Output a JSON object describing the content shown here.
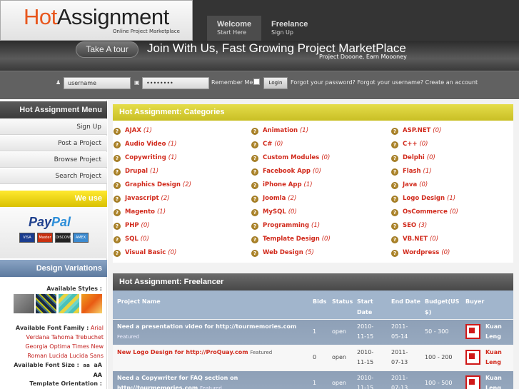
{
  "logo": {
    "hot": "Hot",
    "assignment": "Assignment",
    "subtitle": "Online Project Marketplace"
  },
  "nav": [
    {
      "main": "Welcome",
      "sub": "Start Here"
    },
    {
      "main": "Freelance",
      "sub": "Sign Up"
    }
  ],
  "banner": {
    "tour_button": "Take A tour",
    "headline": "Join With Us, Fast Growing Project MarketPlace",
    "tagline": "Project Dooone,  Earn Moooney"
  },
  "login": {
    "username_value": "username",
    "password_value": "••••••••",
    "remember_label": "Remember Me",
    "login_button": "Login",
    "forgot_text": "Forgot your password? Forgot your username? Create an account",
    "user_icon": "user-icon",
    "lock_icon": "lock-icon"
  },
  "sidebar": {
    "menu_title": "Hot Assignment Menu",
    "items": [
      "Sign Up",
      "Post a Project",
      "Browse Project",
      "Search Project"
    ],
    "we_use": "We use",
    "paypal": {
      "pay": "Pay",
      "pal": "Pal"
    },
    "cards": [
      "VISA",
      "Master",
      "DISCOVER",
      "AMEX"
    ],
    "design_title": "Design Variations",
    "styles_label": "Available Styles :",
    "font_family_label": "Available Font Family :",
    "fonts": [
      "Arial",
      "Verdana",
      "Tahoma",
      "Trebuchet",
      "Georgia",
      "Optima",
      "Times New Roman",
      "Lucida",
      "Lucida Sans"
    ],
    "font_size_label": "Available Font Size :",
    "font_sizes": [
      "aa",
      "aA",
      "AA"
    ],
    "orientation_label": "Template Orientation :"
  },
  "categories": {
    "title": "Hot Assignment: Categories",
    "items": [
      {
        "name": "AJAX",
        "count": "(1)"
      },
      {
        "name": "Animation",
        "count": "(1)"
      },
      {
        "name": "ASP.NET",
        "count": "(0)"
      },
      {
        "name": "Audio Video",
        "count": "(1)"
      },
      {
        "name": "C#",
        "count": "(0)"
      },
      {
        "name": "C++",
        "count": "(0)"
      },
      {
        "name": "Copywriting",
        "count": "(1)"
      },
      {
        "name": "Custom Modules",
        "count": "(0)"
      },
      {
        "name": "Delphi",
        "count": "(0)"
      },
      {
        "name": "Drupal",
        "count": "(1)"
      },
      {
        "name": "Facebook App",
        "count": "(0)"
      },
      {
        "name": "Flash",
        "count": "(1)"
      },
      {
        "name": "Graphics Design",
        "count": "(2)"
      },
      {
        "name": "iPhone App",
        "count": "(1)"
      },
      {
        "name": "Java",
        "count": "(0)"
      },
      {
        "name": "Javascript",
        "count": "(2)"
      },
      {
        "name": "Joomla",
        "count": "(2)"
      },
      {
        "name": "Logo Design",
        "count": "(1)"
      },
      {
        "name": "Magento",
        "count": "(1)"
      },
      {
        "name": "MySQL",
        "count": "(0)"
      },
      {
        "name": "OsCommerce",
        "count": "(0)"
      },
      {
        "name": "PHP",
        "count": "(0)"
      },
      {
        "name": "Programming",
        "count": "(1)"
      },
      {
        "name": "SEO",
        "count": "(3)"
      },
      {
        "name": "SQL",
        "count": "(0)"
      },
      {
        "name": "Template Design",
        "count": "(0)"
      },
      {
        "name": "VB.NET",
        "count": "(0)"
      },
      {
        "name": "Visual Basic",
        "count": "(0)"
      },
      {
        "name": "Web Design",
        "count": "(5)"
      },
      {
        "name": "Wordpress",
        "count": "(0)"
      }
    ]
  },
  "freelancer": {
    "title": "Hot Assignment: Freelancer",
    "columns": {
      "project": "Project Name",
      "bids": "Bids",
      "status": "Status",
      "start": "Start Date",
      "end": "End Date",
      "budget": "Budget(US $)",
      "buyer": "Buyer"
    },
    "rows": [
      {
        "title": "Need a presentation video for http://tourmemories.com",
        "tag": "Featured",
        "bids": "1",
        "status": "open",
        "start": "2010-11-15",
        "end": "2011-05-14",
        "budget": "50 - 300",
        "buyer": "Kuan Leng"
      },
      {
        "title": "New Logo Design for http://ProQuay.com",
        "tag": "Featured",
        "bids": "0",
        "status": "open",
        "start": "2010-11-15",
        "end": "2011-07-13",
        "budget": "100 - 200",
        "buyer": "Kuan Leng"
      },
      {
        "title": "Need a Copywriter for FAQ section on http://tourmemories.com",
        "tag": "Featured",
        "bids": "1",
        "status": "open",
        "start": "2010-11-15",
        "end": "2011-07-13",
        "budget": "100 - 500",
        "buyer": "Kuan Leng"
      }
    ]
  },
  "colors": {
    "accent": "#d12a1c",
    "category_header": "#d6cd33",
    "table_header": "#a1b5cc",
    "row_alt": "#8fa1b8"
  }
}
